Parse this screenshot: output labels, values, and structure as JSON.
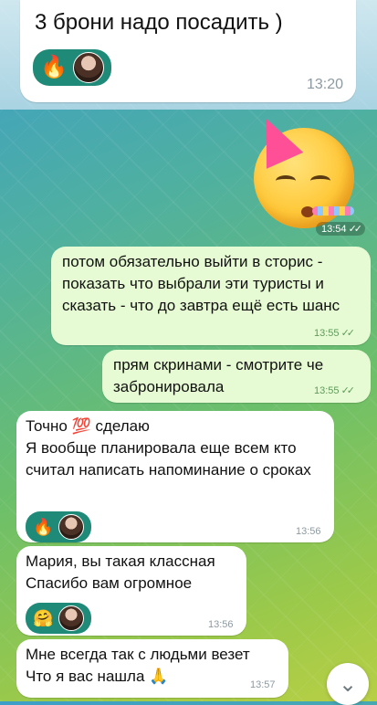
{
  "top_message": {
    "text": "3 брони надо посадить )",
    "time": "13:20",
    "reactions": [
      "🔥"
    ]
  },
  "sticker": {
    "time": "13:54",
    "icon": "party-whistle-emoji-sticker"
  },
  "messages": [
    {
      "direction": "out",
      "text": "потом обязательно выйти в сторис - показать что выбрали эти туристы и сказать - что до завтра ещё есть шанс",
      "time": "13:55"
    },
    {
      "direction": "out",
      "text": "прям скринами - смотрите че забронировала",
      "time": "13:55"
    },
    {
      "direction": "in",
      "text": "Точно 💯 сделаю\nЯ вообще планировала еще всем кто считал написать напоминание о сроках",
      "time": "13:56",
      "reactions": [
        "🔥"
      ]
    },
    {
      "direction": "in",
      "text": "Мария, вы такая классная\nСпасибо вам огромное",
      "time": "13:56",
      "reactions": [
        "🤗"
      ]
    },
    {
      "direction": "in",
      "text": "Мне всегда так с людьми везет\nЧто я вас нашла 🙏",
      "time": "13:57"
    }
  ],
  "scroll_button": {
    "icon": "chevron-down-icon"
  },
  "colors": {
    "out_bubble": "#e6fbd3",
    "in_bubble": "#ffffff",
    "reaction_bg": "#1f8a78"
  }
}
